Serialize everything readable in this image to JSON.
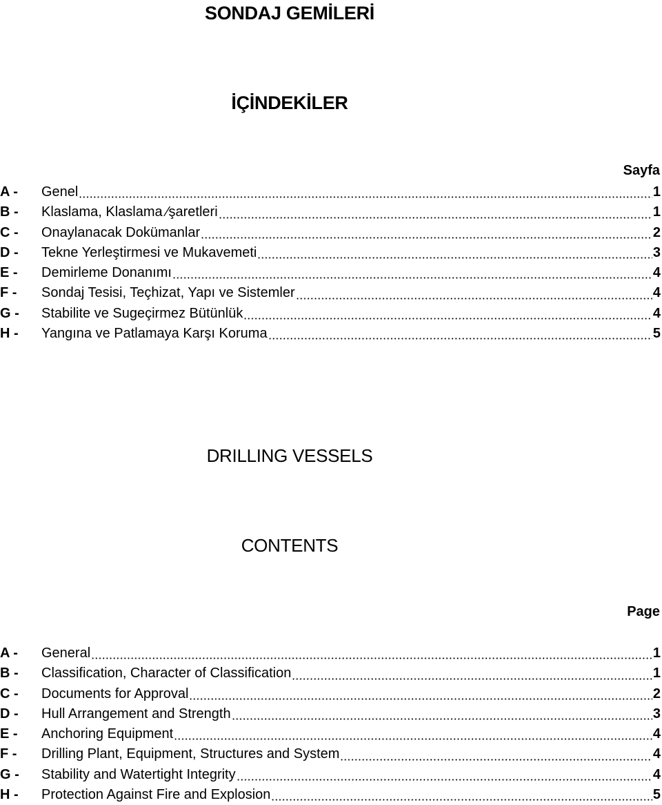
{
  "turkish": {
    "title": "SONDAJ GEMİLERİ",
    "subtitle": "İÇİNDEKİLER",
    "page_header": "Sayfa",
    "entries": [
      {
        "letter": "A -",
        "label": "Genel ",
        "page": "1"
      },
      {
        "letter": "B -",
        "label": "Klaslama, Klaslama ⁄şaretleri ",
        "page": "1"
      },
      {
        "letter": "C -",
        "label": "Onaylanacak Dokümanlar",
        "page": "2"
      },
      {
        "letter": "D -",
        "label": "Tekne Yerleştirmesi ve Mukavemeti ",
        "page": "3"
      },
      {
        "letter": "E -",
        "label": "Demirleme  Donanımı ",
        "page": "4"
      },
      {
        "letter": "F -",
        "label": "Sondaj Tesisi, Teçhizat, Yapı ve Sistemler",
        "page": "4"
      },
      {
        "letter": "G -",
        "label": "Stabilite ve Sugeçirmez Bütünlük ",
        "page": "4"
      },
      {
        "letter": "H -",
        "label": "Yangına ve Patlamaya Karşı Koruma",
        "page": "5"
      }
    ]
  },
  "english": {
    "title": "DRILLING VESSELS",
    "subtitle": "CONTENTS",
    "page_header": "Page",
    "entries": [
      {
        "letter": "A -",
        "label": "General ",
        "page": "1"
      },
      {
        "letter": "B -",
        "label": "Classification, Character of Classification",
        "page": "1"
      },
      {
        "letter": "C -",
        "label": "Documents for Approval ",
        "page": "2"
      },
      {
        "letter": "D -",
        "label": "Hull Arrangement and Strength ",
        "page": "3"
      },
      {
        "letter": "E -",
        "label": "Anchoring  Equipment",
        "page": "4"
      },
      {
        "letter": "F -",
        "label": "Drilling Plant, Equipment, Structures and System ",
        "page": "4"
      },
      {
        "letter": "G -",
        "label": "Stability and Watertight Integrity ",
        "page": "4"
      },
      {
        "letter": "H -",
        "label": "Protection Against Fire and Explosion ",
        "page": "5"
      }
    ]
  }
}
